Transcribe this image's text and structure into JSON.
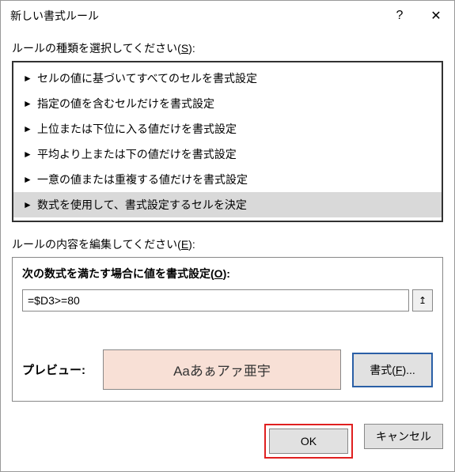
{
  "titlebar": {
    "title": "新しい書式ルール",
    "help": "?",
    "close": "✕"
  },
  "sections": {
    "rule_type_label_pre": "ルールの種類を選択してください(",
    "rule_type_label_key": "S",
    "rule_type_label_post": "):",
    "rule_edit_label_pre": "ルールの内容を編集してください(",
    "rule_edit_label_key": "E",
    "rule_edit_label_post": "):"
  },
  "rule_types": {
    "items": [
      {
        "label": "セルの値に基づいてすべてのセルを書式設定"
      },
      {
        "label": "指定の値を含むセルだけを書式設定"
      },
      {
        "label": "上位または下位に入る値だけを書式設定"
      },
      {
        "label": "平均より上または下の値だけを書式設定"
      },
      {
        "label": "一意の値または重複する値だけを書式設定"
      },
      {
        "label": "数式を使用して、書式設定するセルを決定"
      }
    ],
    "selected_index": 5
  },
  "edit": {
    "formula_label_pre": "次の数式を満たす場合に値を書式設定(",
    "formula_label_key": "O",
    "formula_label_post": "):",
    "formula_value": "=$D3>=80",
    "ref_icon": "↥"
  },
  "preview": {
    "label": "プレビュー:",
    "sample": "Aaあぁアァ亜宇",
    "format_btn_pre": "書式(",
    "format_btn_key": "F",
    "format_btn_post": ")..."
  },
  "buttons": {
    "ok": "OK",
    "cancel": "キャンセル"
  }
}
